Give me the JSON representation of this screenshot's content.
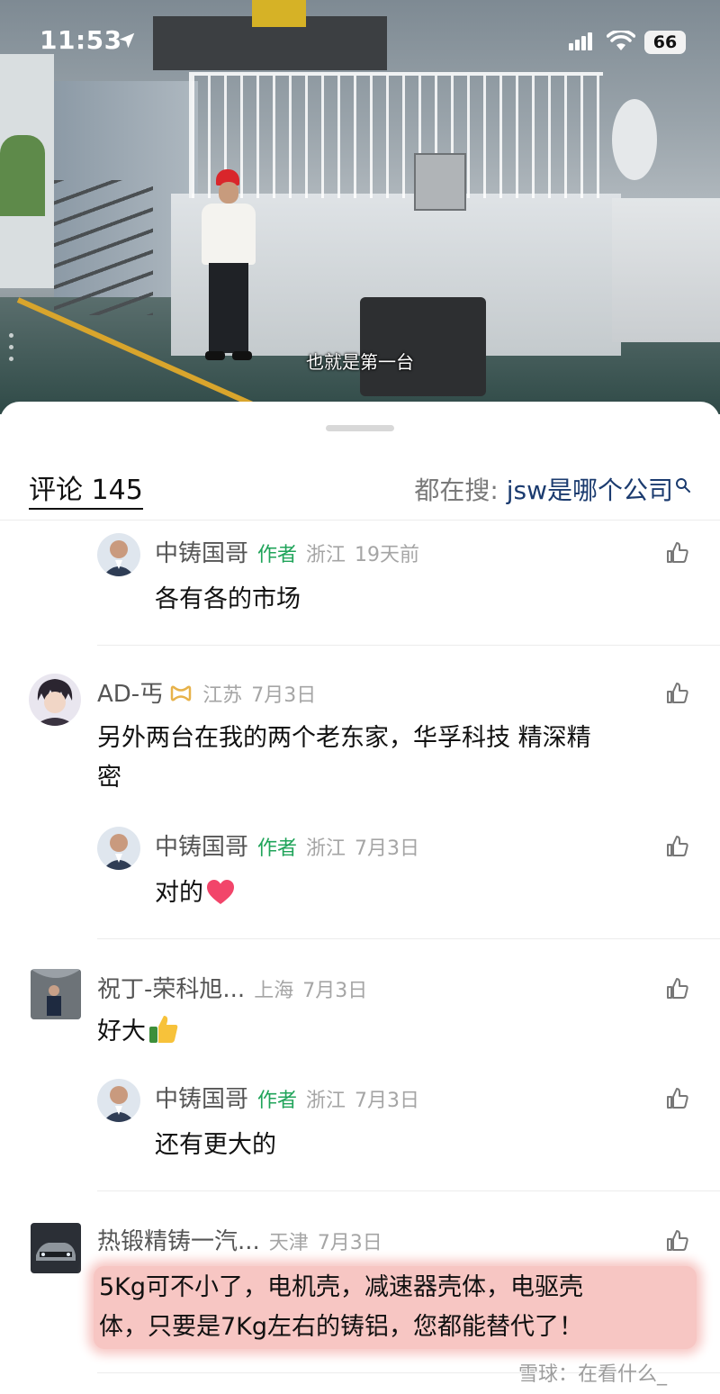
{
  "status_bar": {
    "time": "11:53",
    "battery": "66"
  },
  "video": {
    "subtitle": "也就是第一台"
  },
  "sheet": {
    "comments_label": "评论 145",
    "search_label": "都在搜: ",
    "search_keyword": "jsw是哪个公司"
  },
  "comments": [
    {
      "name": "中铸国哥",
      "tag": "作者",
      "location": "浙江",
      "time": "19天前",
      "text": "各有各的市场"
    },
    {
      "name": "AD-丐",
      "location": "江苏",
      "time": "7月3日",
      "text_line1": "另外两台在我的两个老东家，华孚科技 精深精",
      "text_line2": "密"
    },
    {
      "name": "中铸国哥",
      "tag": "作者",
      "location": "浙江",
      "time": "7月3日",
      "text": "对的"
    },
    {
      "name": "祝丁-荣科旭...",
      "location": "上海",
      "time": "7月3日",
      "text": "好大"
    },
    {
      "name": "中铸国哥",
      "tag": "作者",
      "location": "浙江",
      "time": "7月3日",
      "text": "还有更大的"
    },
    {
      "name": "热锻精铸一汽...",
      "location": "天津",
      "time": "7月3日",
      "text_line1": "5Kg可不小了，电机壳，减速器壳体，电驱壳",
      "text_line2": "体，只要是7Kg左右的铸铝，您都能替代了！"
    }
  ],
  "watermark": "雪球：在看什么_",
  "icons": {
    "like": "thumb-up-icon",
    "search": "search-icon",
    "heart_emoji": "heart-icon",
    "thumbs_emoji": "thumbs-up-emoji-icon"
  },
  "colors": {
    "author_tag": "#20a45a",
    "highlight": "#f7c6c3",
    "search_keyword": "#1b3b6f"
  }
}
